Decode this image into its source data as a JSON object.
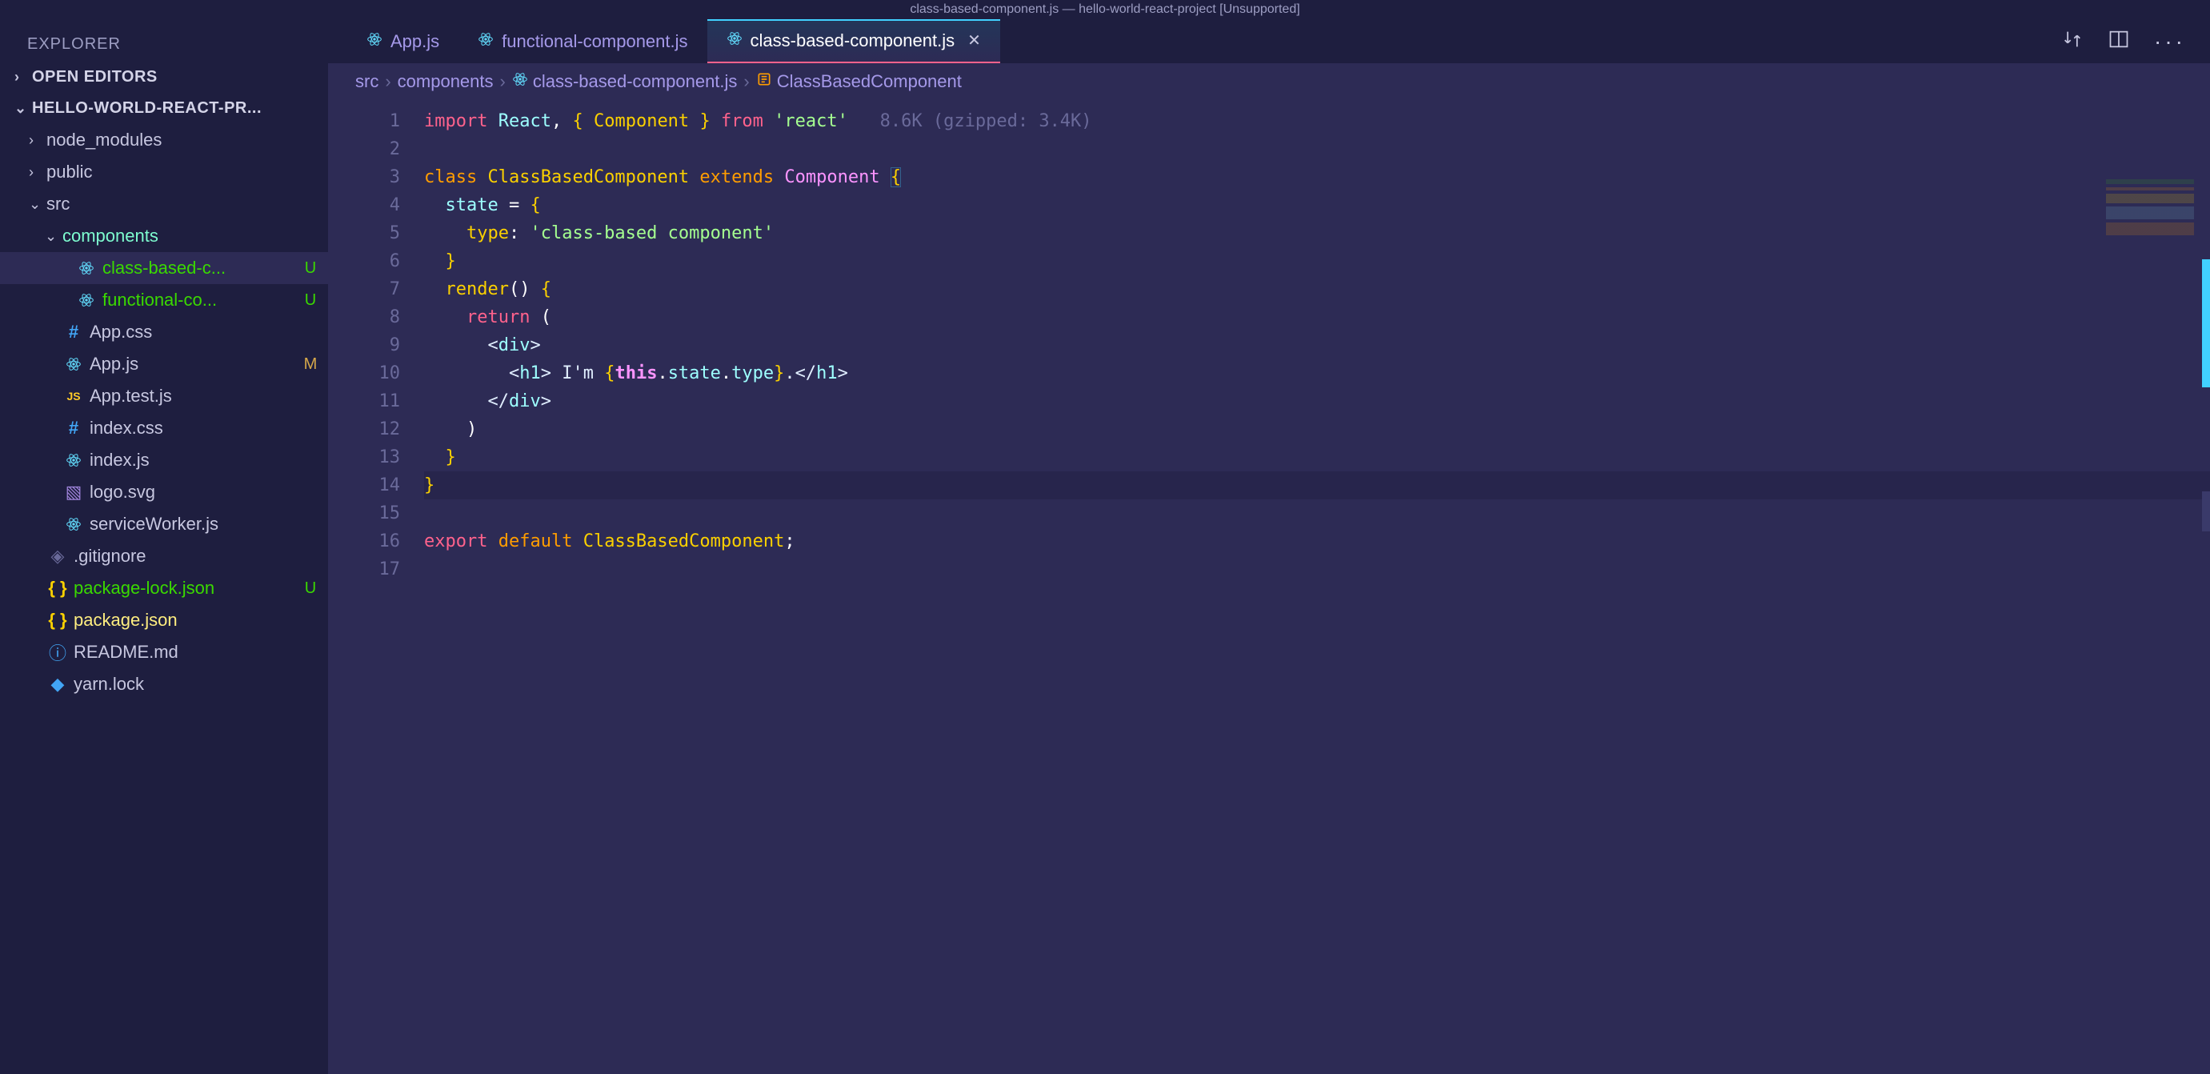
{
  "titlebar": "class-based-component.js — hello-world-react-project [Unsupported]",
  "sidebar": {
    "title": "EXPLORER",
    "sections": {
      "open_editors": "OPEN EDITORS",
      "project": "HELLO-WORLD-REACT-PR..."
    },
    "tree": [
      {
        "label": "node_modules",
        "type": "folder",
        "depth": 1,
        "chev": ">"
      },
      {
        "label": "public",
        "type": "folder",
        "depth": 1,
        "chev": ">"
      },
      {
        "label": "src",
        "type": "folder",
        "depth": 1,
        "chev": "v",
        "dot": "gray"
      },
      {
        "label": "components",
        "type": "folder",
        "depth": 2,
        "chev": "v",
        "green": true,
        "dot": "green"
      },
      {
        "label": "class-based-c...",
        "type": "react",
        "depth": 3,
        "status": "U",
        "active": true
      },
      {
        "label": "functional-co...",
        "type": "react",
        "depth": 3,
        "status": "U"
      },
      {
        "label": "App.css",
        "type": "css",
        "depth": 2
      },
      {
        "label": "App.js",
        "type": "react",
        "depth": 2,
        "status": "M"
      },
      {
        "label": "App.test.js",
        "type": "js",
        "depth": 2
      },
      {
        "label": "index.css",
        "type": "css",
        "depth": 2
      },
      {
        "label": "index.js",
        "type": "react",
        "depth": 2
      },
      {
        "label": "logo.svg",
        "type": "svg",
        "depth": 2
      },
      {
        "label": "serviceWorker.js",
        "type": "react",
        "depth": 2
      },
      {
        "label": ".gitignore",
        "type": "git",
        "depth": 1
      },
      {
        "label": "package-lock.json",
        "type": "json",
        "depth": 1,
        "status": "U",
        "yellow": true
      },
      {
        "label": "package.json",
        "type": "json",
        "depth": 1,
        "yellow": true
      },
      {
        "label": "README.md",
        "type": "md",
        "depth": 1
      },
      {
        "label": "yarn.lock",
        "type": "lock",
        "depth": 1
      }
    ]
  },
  "tabs": [
    {
      "label": "App.js",
      "icon": "react"
    },
    {
      "label": "functional-component.js",
      "icon": "react"
    },
    {
      "label": "class-based-component.js",
      "icon": "react",
      "active": true,
      "close": true
    }
  ],
  "breadcrumb": [
    {
      "label": "src"
    },
    {
      "label": "components"
    },
    {
      "label": "class-based-component.js",
      "icon": "react"
    },
    {
      "label": "ClassBasedComponent",
      "icon": "symbol"
    }
  ],
  "code": {
    "hint": "8.6K (gzipped: 3.4K)",
    "lines": 17,
    "tokens": {
      "import": "import",
      "react": "React",
      "component": "Component",
      "from": "from",
      "reactstr": "'react'",
      "class": "class",
      "cbname": "ClassBasedComponent",
      "extends": "extends",
      "state": "state",
      "type": "type",
      "typestr": "'class-based component'",
      "render": "render",
      "return": "return",
      "div": "div",
      "h1": "h1",
      "im": "I'm ",
      "this": "this",
      "dotstate": "state",
      "dottype": "type",
      "export": "export",
      "default": "default"
    }
  }
}
